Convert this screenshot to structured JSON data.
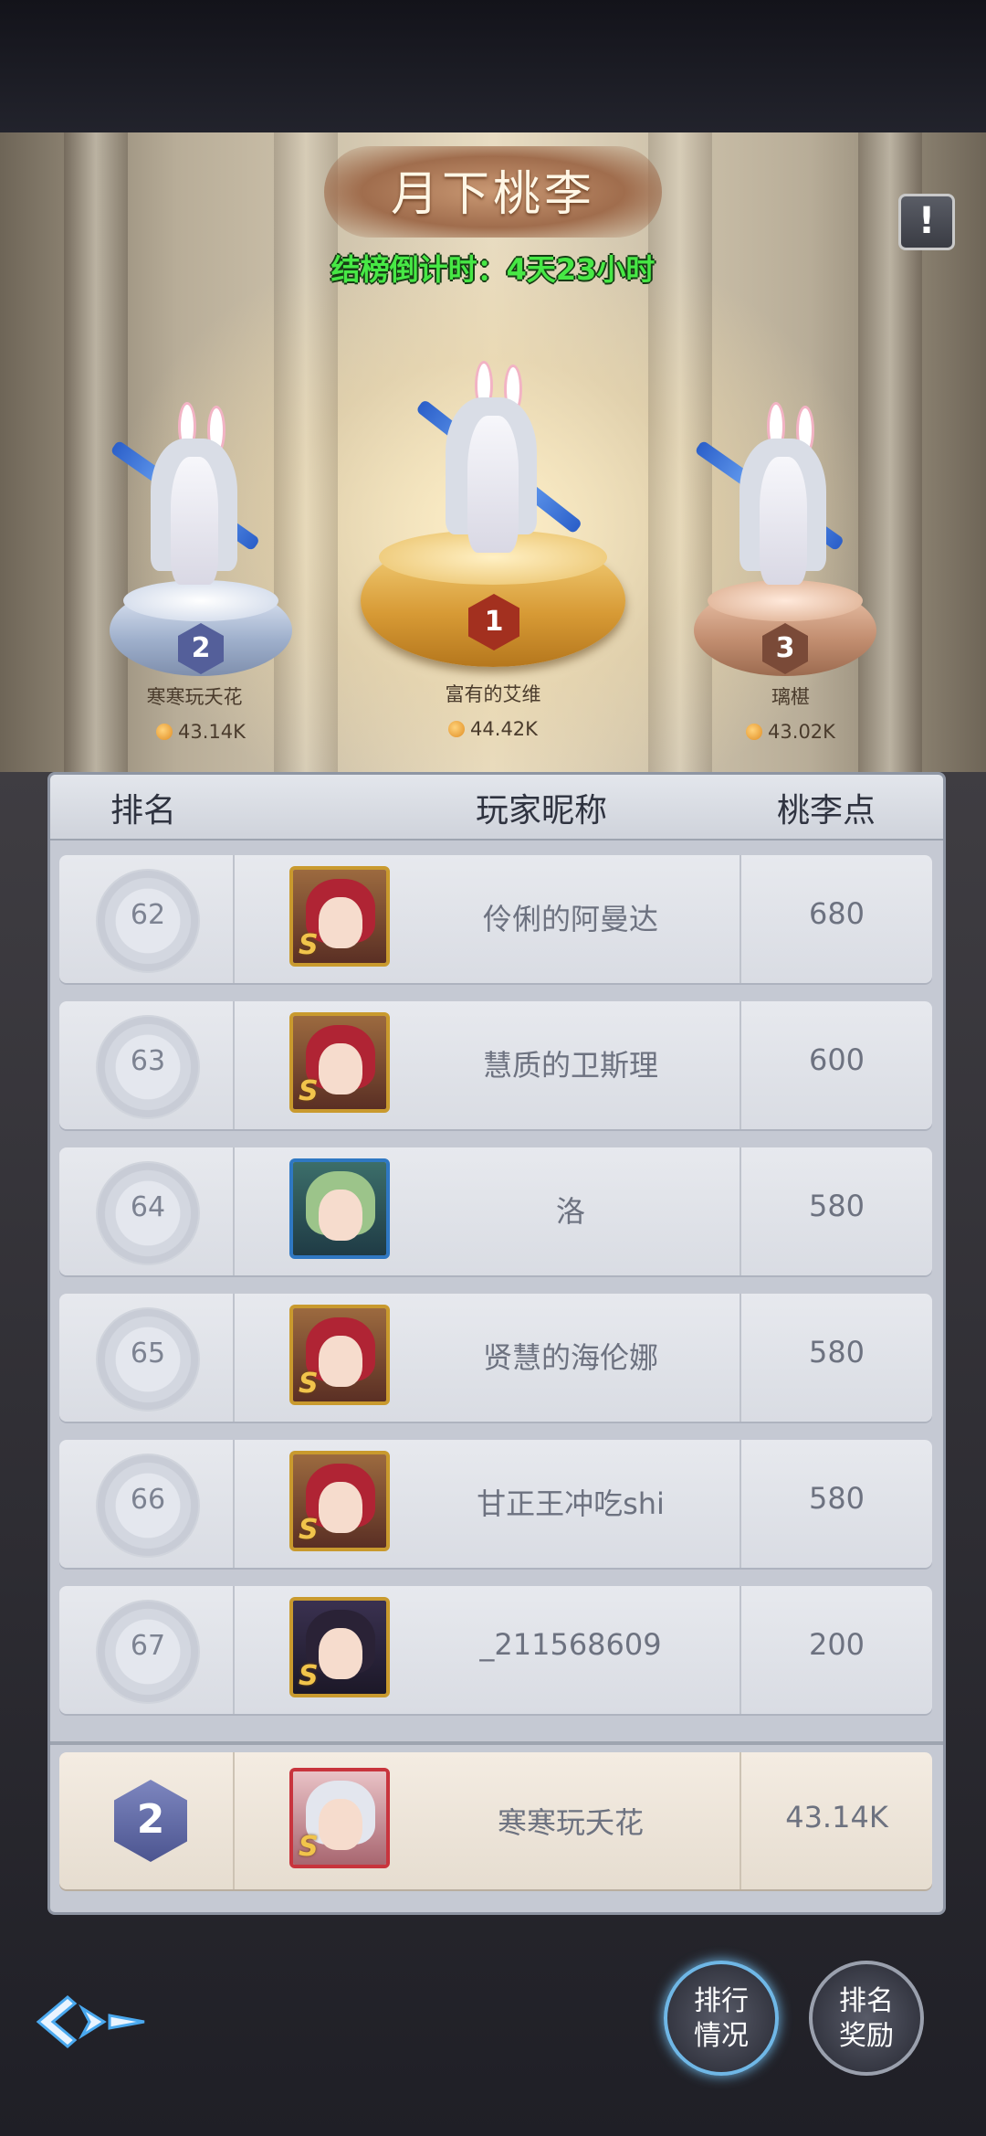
{
  "header": {
    "title": "月下桃李",
    "countdown": "结榜倒计时：4天23小时",
    "info_icon": "exclamation-icon"
  },
  "top3": [
    {
      "rank": "1",
      "name": "富有的艾维",
      "score": "44.42K"
    },
    {
      "rank": "2",
      "name": "寒寒玩夭花",
      "score": "43.14K"
    },
    {
      "rank": "3",
      "name": "璃椹",
      "score": "43.02K"
    }
  ],
  "table": {
    "headers": {
      "rank": "排名",
      "nickname": "玩家昵称",
      "points": "桃李点"
    },
    "rows": [
      {
        "rank": "62",
        "nickname": "伶俐的阿曼达",
        "points": "680",
        "avatar": "red-hair-hero"
      },
      {
        "rank": "63",
        "nickname": "慧质的卫斯理",
        "points": "600",
        "avatar": "red-hair-hero"
      },
      {
        "rank": "64",
        "nickname": "洛",
        "points": "580",
        "avatar": "green-hair-elf"
      },
      {
        "rank": "65",
        "nickname": "贤慧的海伦娜",
        "points": "580",
        "avatar": "red-hair-hero"
      },
      {
        "rank": "66",
        "nickname": "甘正王冲吃shi",
        "points": "580",
        "avatar": "red-hair-hero"
      },
      {
        "rank": "67",
        "nickname": "_211568609",
        "points": "200",
        "avatar": "dark-hair-girl"
      }
    ],
    "me": {
      "rank": "2",
      "nickname": "寒寒玩夭花",
      "points": "43.14K",
      "avatar": "bunny-girl"
    }
  },
  "bottom": {
    "ranking_status_label_1": "排行",
    "ranking_status_label_2": "情况",
    "ranking_reward_label_1": "排名",
    "ranking_reward_label_2": "奖励",
    "back_icon": "back-logo-icon"
  }
}
